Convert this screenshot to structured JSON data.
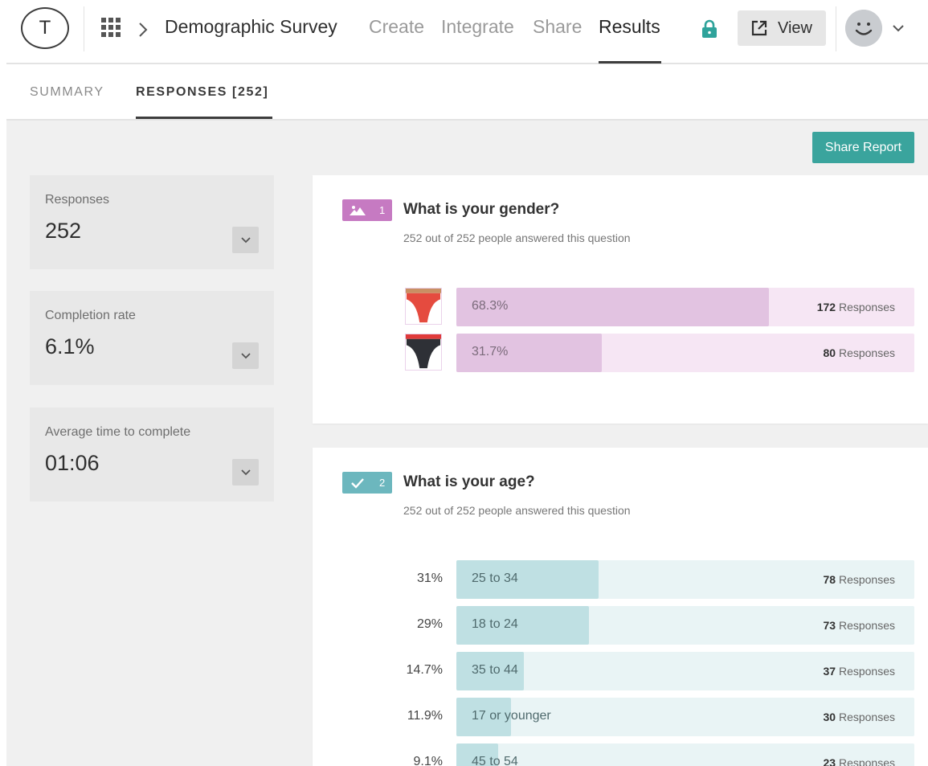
{
  "header": {
    "logo_letter": "T",
    "breadcrumb_title": "Demographic Survey",
    "nav": [
      {
        "label": "Create",
        "active": false
      },
      {
        "label": "Integrate",
        "active": false
      },
      {
        "label": "Share",
        "active": false
      },
      {
        "label": "Results",
        "active": true
      }
    ],
    "lock_icon": "lock-icon",
    "view_label": "View",
    "avatar_icon": "smiley-avatar"
  },
  "tabs": [
    {
      "label": "SUMMARY",
      "active": false
    },
    {
      "label": "RESPONSES [252]",
      "active": true
    }
  ],
  "share_report_label": "Share Report",
  "stats": [
    {
      "label": "Responses",
      "value": "252"
    },
    {
      "label": "Completion rate",
      "value": "6.1%"
    },
    {
      "label": "Average time to complete",
      "value": "01:06"
    }
  ],
  "questions": [
    {
      "number": "1",
      "badge_icon": "picture-choice-icon",
      "title": "What is your gender?",
      "subtitle": "252 out of 252 people answered this question",
      "accent": "#c67ac2",
      "options": [
        {
          "image": "red-underwear-icon",
          "percent": "68.3%",
          "share": 0.683,
          "count": "172",
          "count_suffix": "Responses"
        },
        {
          "image": "black-underwear-icon",
          "percent": "31.7%",
          "share": 0.317,
          "count": "80",
          "count_suffix": "Responses"
        }
      ]
    },
    {
      "number": "2",
      "badge_icon": "multiple-choice-check-icon",
      "title": "What is your age?",
      "subtitle": "252 out of 252 people answered this question",
      "accent": "#6cb7be",
      "options": [
        {
          "percent": "31%",
          "label": "25 to 34",
          "share": 0.31,
          "count": "78",
          "count_suffix": "Responses"
        },
        {
          "percent": "29%",
          "label": "18 to 24",
          "share": 0.29,
          "count": "73",
          "count_suffix": "Responses"
        },
        {
          "percent": "14.7%",
          "label": "35 to 44",
          "share": 0.147,
          "count": "37",
          "count_suffix": "Responses"
        },
        {
          "percent": "11.9%",
          "label": "17 or younger",
          "share": 0.119,
          "count": "30",
          "count_suffix": "Responses"
        },
        {
          "percent": "9.1%",
          "label": "45 to 54",
          "share": 0.091,
          "count": "23",
          "count_suffix": "Responses"
        }
      ]
    }
  ],
  "colors": {
    "accent_teal": "#3aa49d",
    "lock_green": "#2fa39b"
  }
}
